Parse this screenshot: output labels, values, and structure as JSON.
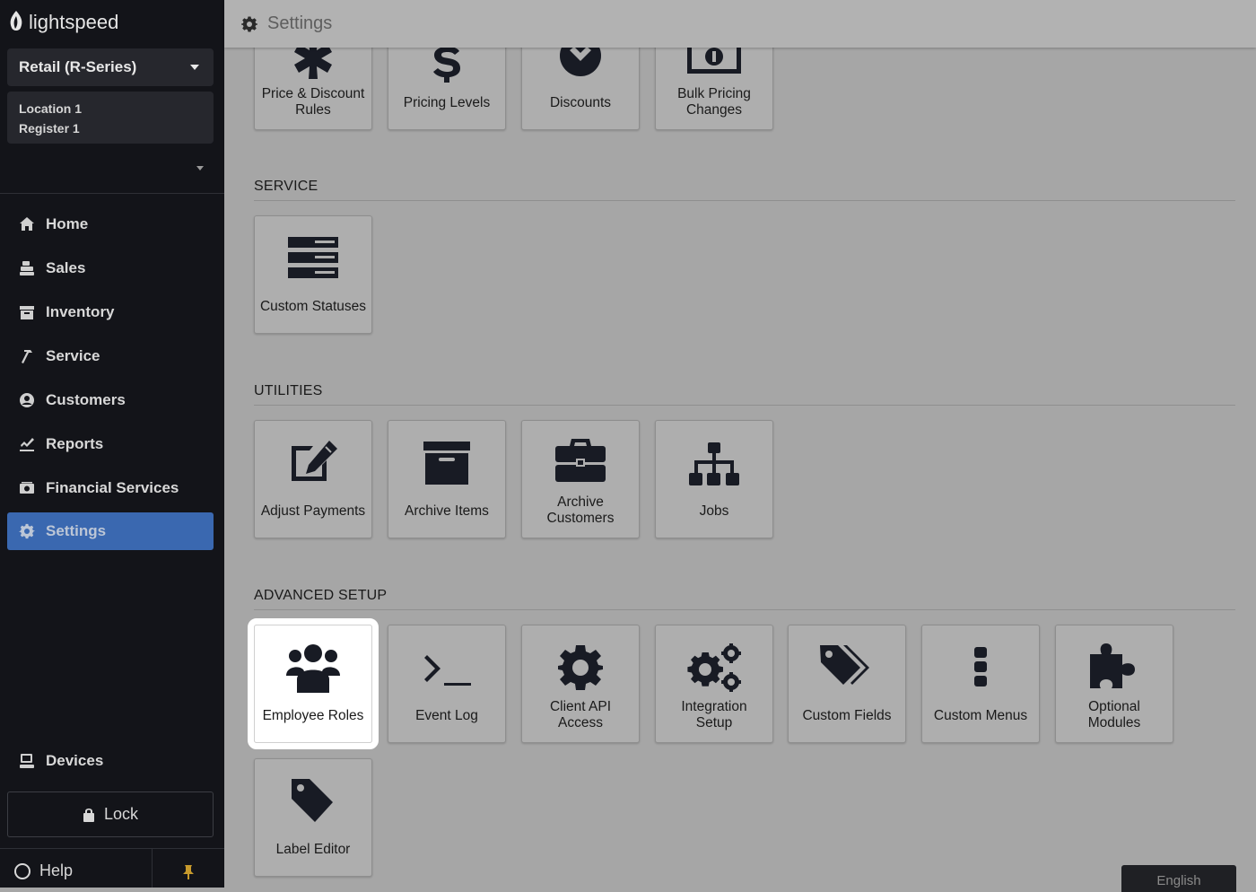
{
  "sidebar": {
    "brand": "lightspeed",
    "account": "Retail (R-Series)",
    "location": "Location 1",
    "register": "Register 1",
    "nav": [
      {
        "label": "Home",
        "icon": "home-icon"
      },
      {
        "label": "Sales",
        "icon": "register-icon"
      },
      {
        "label": "Inventory",
        "icon": "inventory-icon"
      },
      {
        "label": "Service",
        "icon": "hammer-icon"
      },
      {
        "label": "Customers",
        "icon": "user-circle-icon"
      },
      {
        "label": "Reports",
        "icon": "chart-check-icon"
      },
      {
        "label": "Financial Services",
        "icon": "money-icon"
      },
      {
        "label": "Settings",
        "icon": "gear-icon",
        "active": true
      }
    ],
    "devices": "Devices",
    "lock": "Lock",
    "help": "Help"
  },
  "header": {
    "title": "Settings"
  },
  "sections": {
    "pricing": {
      "tiles": [
        "Price & Discount Rules",
        "Pricing Levels",
        "Discounts",
        "Bulk Pricing Changes"
      ]
    },
    "service": {
      "heading": "SERVICE",
      "tiles": [
        "Custom Statuses"
      ]
    },
    "utilities": {
      "heading": "UTILITIES",
      "tiles": [
        "Adjust Payments",
        "Archive Items",
        "Archive Customers",
        "Jobs"
      ]
    },
    "advanced": {
      "heading": "ADVANCED SETUP",
      "tiles": [
        "Employee Roles",
        "Event Log",
        "Client API Access",
        "Integration Setup",
        "Custom Fields",
        "Custom Menus",
        "Optional Modules",
        "Label Editor"
      ]
    }
  },
  "footer": {
    "language": "English"
  },
  "colors": {
    "sidebar": "#131419",
    "active_nav": "#3a68b0",
    "content_bg": "#a6a6a6",
    "highlight": "#ffffff"
  }
}
